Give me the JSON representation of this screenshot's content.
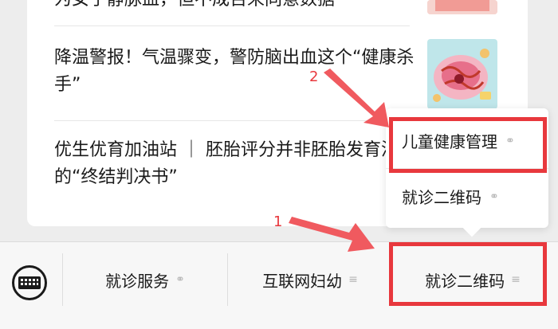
{
  "articles": [
    {
      "title": "为女子静脉血，但不成百来同意数据",
      "partial": true
    },
    {
      "title": "降温警报！气温骤变，警防脑出血这个“健康杀手”"
    },
    {
      "title": "优生优育加油站 ｜ 胚胎评分并非胚胎发育潜能的“终结判决书”"
    }
  ],
  "popup": {
    "items": [
      {
        "label": "儿童健康管理",
        "icon": "link-icon"
      },
      {
        "label": "就诊二维码",
        "icon": "link-icon"
      }
    ]
  },
  "menu": {
    "items": [
      {
        "label": "就诊服务",
        "icon": "link-icon"
      },
      {
        "label": "互联网妇幼",
        "icon": "menu-lines-icon"
      },
      {
        "label": "就诊二维码",
        "icon": "menu-lines-icon"
      }
    ]
  },
  "annotations": [
    "1",
    "2"
  ],
  "colors": {
    "highlight": "#e8383d",
    "accent_icon": "#b5b5b5"
  }
}
